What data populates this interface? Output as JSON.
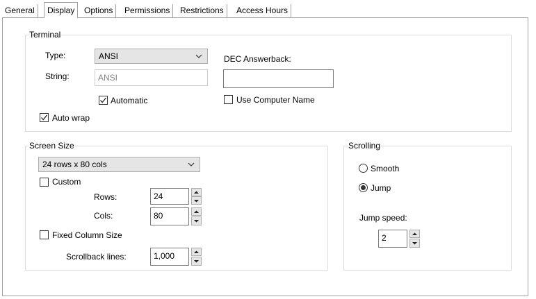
{
  "tabs": [
    "General",
    "Display",
    "Options",
    "Permissions",
    "Restrictions",
    "Access Hours"
  ],
  "terminal": {
    "legend": "Terminal",
    "type_label": "Type:",
    "type_value": "ANSI",
    "string_label": "String:",
    "string_value": "ANSI",
    "automatic_label": "Automatic",
    "automatic_checked": true,
    "auto_wrap_label": "Auto wrap",
    "auto_wrap_checked": true,
    "dec_answerback_label": "DEC Answerback:",
    "dec_answerback_value": "",
    "use_computer_name_label": "Use Computer Name",
    "use_computer_name_checked": false
  },
  "screen_size": {
    "legend": "Screen Size",
    "size_value": "24 rows x 80 cols",
    "custom_label": "Custom",
    "custom_checked": false,
    "rows_label": "Rows:",
    "rows_value": "24",
    "cols_label": "Cols:",
    "cols_value": "80",
    "fixed_column_label": "Fixed Column Size",
    "fixed_column_checked": false,
    "scrollback_label": "Scrollback lines:",
    "scrollback_value": "1,000"
  },
  "scrolling": {
    "legend": "Scrolling",
    "smooth_label": "Smooth",
    "jump_label": "Jump",
    "selected": "Jump",
    "jump_speed_label": "Jump speed:",
    "jump_speed_value": "2"
  },
  "icons": {
    "check": "checkmark-icon",
    "chevron": "chevron-down-icon",
    "spin_up": "spin-up-arrow-icon",
    "spin_down": "spin-down-arrow-icon"
  }
}
